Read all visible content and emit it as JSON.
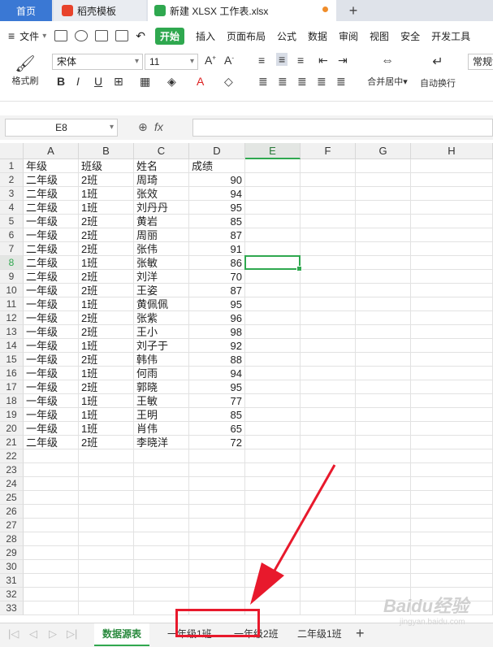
{
  "tabs": {
    "home": "首页",
    "template": "稻壳模板",
    "file": "新建 XLSX 工作表.xlsx",
    "new_tab": "+"
  },
  "menu": {
    "file": "文件",
    "items": [
      "开始",
      "插入",
      "页面布局",
      "公式",
      "数据",
      "审阅",
      "视图",
      "安全",
      "开发工具"
    ]
  },
  "ribbon": {
    "format_painter": "格式刷",
    "font_name": "宋体",
    "font_size": "11",
    "merge_center": "合并居中",
    "wrap_text": "自动换行",
    "number_format": "常规"
  },
  "formula_bar": {
    "name_box": "E8",
    "fx": "fx",
    "formula": ""
  },
  "columns": [
    "A",
    "B",
    "C",
    "D",
    "E",
    "F",
    "G",
    "H"
  ],
  "row_numbers": [
    "1",
    "2",
    "3",
    "4",
    "5",
    "6",
    "7",
    "8",
    "9",
    "10",
    "11",
    "12",
    "13",
    "14",
    "15",
    "16",
    "17",
    "18",
    "19",
    "20",
    "21",
    "22",
    "23",
    "24",
    "25",
    "26",
    "27",
    "28",
    "29",
    "30",
    "31",
    "32",
    "33"
  ],
  "table": {
    "headers": [
      "年级",
      "班级",
      "姓名",
      "成绩"
    ],
    "rows": [
      [
        "二年级",
        "2班",
        "周琦",
        "90"
      ],
      [
        "二年级",
        "1班",
        "张效",
        "94"
      ],
      [
        "二年级",
        "1班",
        "刘丹丹",
        "95"
      ],
      [
        "一年级",
        "2班",
        "黄岩",
        "85"
      ],
      [
        "一年级",
        "2班",
        "周丽",
        "87"
      ],
      [
        "二年级",
        "2班",
        "张伟",
        "91"
      ],
      [
        "二年级",
        "1班",
        "张敏",
        "86"
      ],
      [
        "二年级",
        "2班",
        "刘洋",
        "70"
      ],
      [
        "一年级",
        "2班",
        "王姿",
        "87"
      ],
      [
        "一年级",
        "1班",
        "黄佩佩",
        "95"
      ],
      [
        "一年级",
        "2班",
        "张紫",
        "96"
      ],
      [
        "一年级",
        "2班",
        "王小",
        "98"
      ],
      [
        "一年级",
        "1班",
        "刘子于",
        "92"
      ],
      [
        "一年级",
        "2班",
        "韩伟",
        "88"
      ],
      [
        "一年级",
        "1班",
        "何雨",
        "94"
      ],
      [
        "一年级",
        "2班",
        "郭晓",
        "95"
      ],
      [
        "一年级",
        "1班",
        "王敏",
        "77"
      ],
      [
        "一年级",
        "1班",
        "王明",
        "85"
      ],
      [
        "一年级",
        "1班",
        "肖伟",
        "65"
      ],
      [
        "二年级",
        "2班",
        "李晓洋",
        "72"
      ]
    ]
  },
  "sheet_tabs": [
    "数据源表",
    "一年级1班",
    "一年级2班",
    "二年级1班"
  ],
  "sheet_plus": "+",
  "watermark": "Baidu经验",
  "watermark_sub": "jingyan.baidu.com",
  "colors": {
    "accent": "#2fa84f",
    "annotation": "#e8192c",
    "home_tab": "#3a78d4"
  }
}
